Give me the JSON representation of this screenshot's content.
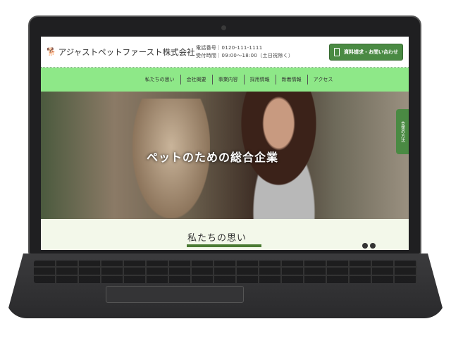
{
  "site": {
    "company": "アジャストペットファースト株式会社",
    "logo_icon": "pet-logo-icon",
    "phone": "電話番号｜0120-111-1111",
    "hours": "受付時間｜09:00〜18:00（土日祝除く）",
    "cta": "資料請求・お問い合わせ"
  },
  "nav": [
    "私たちの思い",
    "会社概要",
    "事業内容",
    "採用情報",
    "新着情報",
    "アクセス"
  ],
  "hero": {
    "title": "ペットのための総合企業"
  },
  "side_tab": "支援の方法",
  "section": {
    "title": "私たちの思い"
  },
  "colors": {
    "nav": "#8ee888",
    "accent": "#4a8a43"
  }
}
